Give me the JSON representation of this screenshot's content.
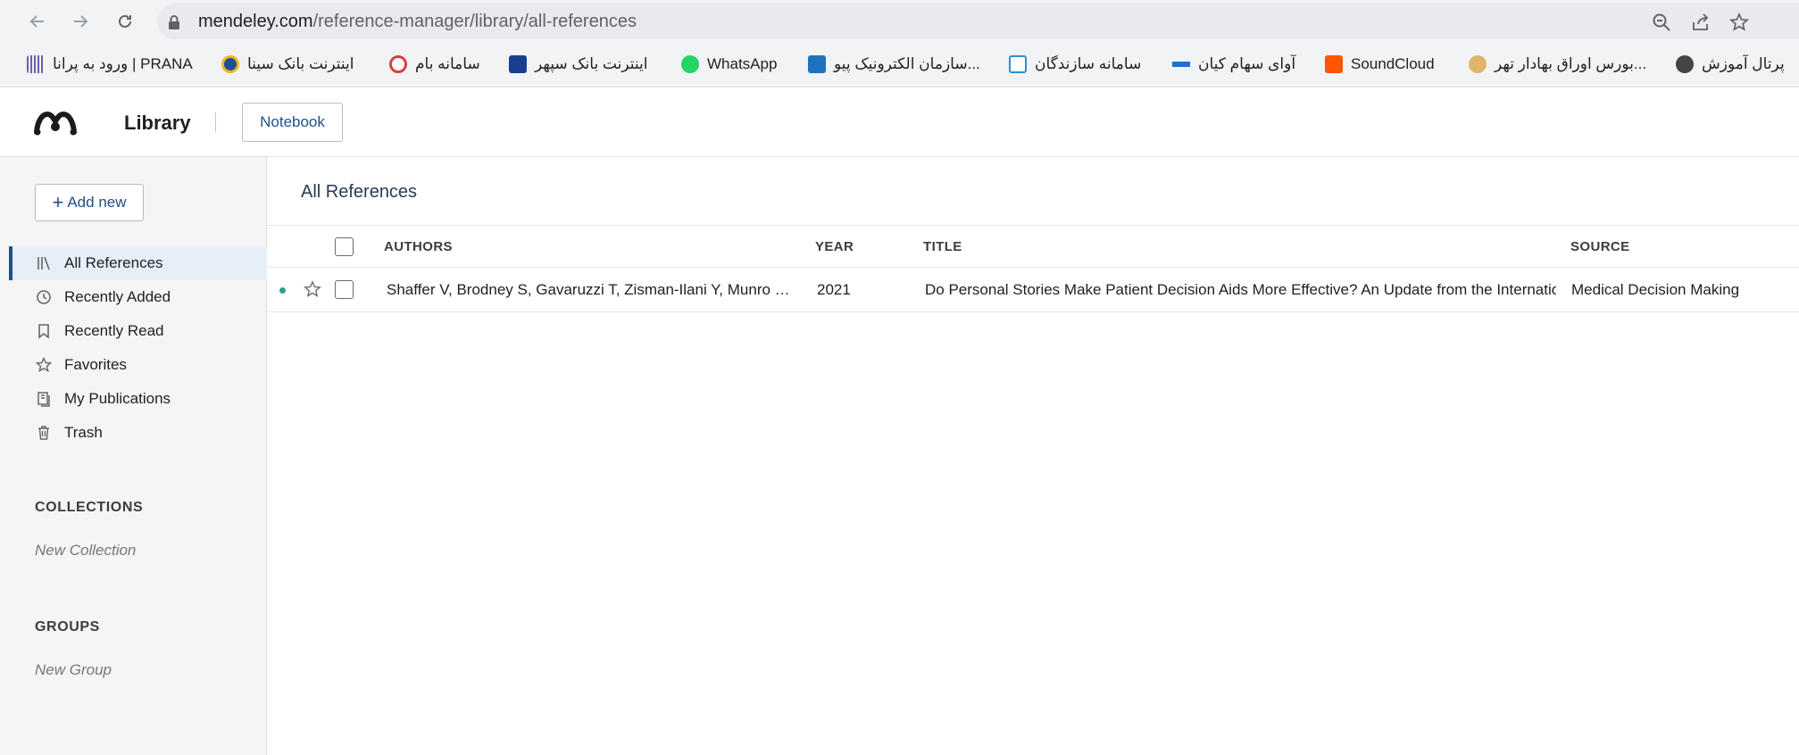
{
  "browser": {
    "url_host": "mendeley.com",
    "url_path": "/reference-manager/library/all-references",
    "bookmarks": [
      {
        "label": "ورود به پرانا | PRANA",
        "icon": "prana-icon",
        "color": "#6b5fa8"
      },
      {
        "label": "اینترنت بانک سینا",
        "icon": "sina-bank-icon",
        "color": "#1d4f9c"
      },
      {
        "label": "سامانه بام",
        "icon": "bam-icon",
        "color": "#d8403a"
      },
      {
        "label": "اینترنت بانک سپهر",
        "icon": "sepah-bank-icon",
        "color": "#1b3f8f"
      },
      {
        "label": "WhatsApp",
        "icon": "whatsapp-icon",
        "color": "#25d366"
      },
      {
        "label": "سازمان الکترونیک پیو...",
        "icon": "outlook-icon",
        "color": "#1e73be"
      },
      {
        "label": "سامانه سازندگان",
        "icon": "sazandegan-icon",
        "color": "#2b8fd6"
      },
      {
        "label": "آوای سهام کیان",
        "icon": "kian-icon",
        "color": "#1f6fd1"
      },
      {
        "label": "SoundCloud",
        "icon": "soundcloud-icon",
        "color": "#ff5500"
      },
      {
        "label": "بورس اوراق بهادار تهر...",
        "icon": "tse-icon",
        "color": "#e0b56a"
      },
      {
        "label": "پرتال آموزش",
        "icon": "globe-icon",
        "color": "#444444"
      }
    ]
  },
  "app": {
    "title": "Library",
    "notebook_label": "Notebook"
  },
  "sidebar": {
    "add_new_label": "Add new",
    "items": [
      {
        "label": "All References",
        "icon": "library-icon",
        "active": true
      },
      {
        "label": "Recently Added",
        "icon": "clock-icon",
        "active": false
      },
      {
        "label": "Recently Read",
        "icon": "bookmark-icon",
        "active": false
      },
      {
        "label": "Favorites",
        "icon": "star-icon",
        "active": false
      },
      {
        "label": "My Publications",
        "icon": "publications-icon",
        "active": false
      },
      {
        "label": "Trash",
        "icon": "trash-icon",
        "active": false
      }
    ],
    "collections_title": "COLLECTIONS",
    "new_collection": "New Collection",
    "groups_title": "GROUPS",
    "new_group": "New Group"
  },
  "main": {
    "title": "All References",
    "columns": {
      "authors": "AUTHORS",
      "year": "YEAR",
      "title": "TITLE",
      "source": "SOURCE"
    },
    "rows": [
      {
        "authors": "Shaffer V, Brodney S, Gavaruzzi T, Zisman-Ilani Y, Munro S,...",
        "year": "2021",
        "title": "Do Personal Stories Make Patient Decision Aids More Effective? An Update from the Internatio",
        "source": "Medical Decision Making",
        "unread": true,
        "favorite": false
      }
    ]
  },
  "colors": {
    "accent": "#1f4f8a",
    "unread_dot": "#2aa188",
    "active_bg": "#e6eef8"
  }
}
